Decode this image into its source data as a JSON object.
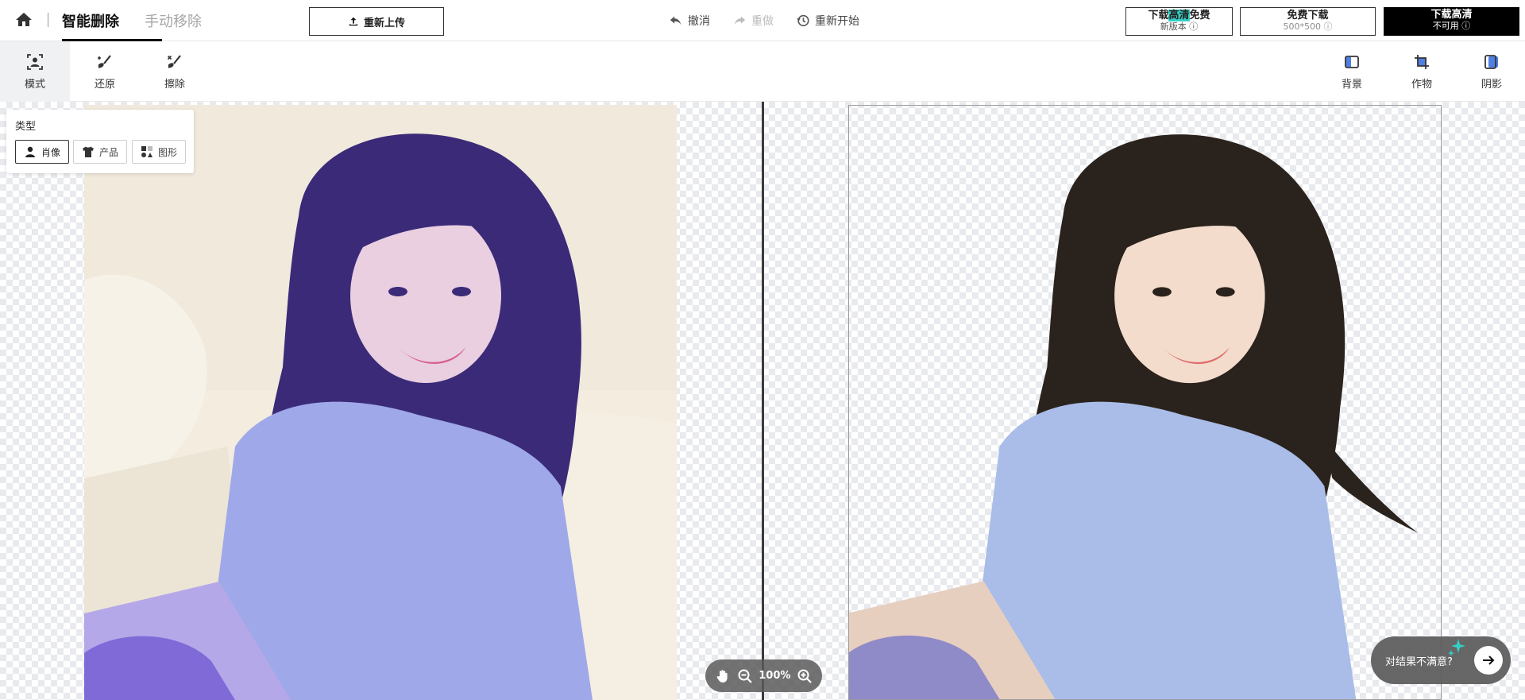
{
  "header": {
    "tabs": [
      {
        "label": "智能删除",
        "active": true
      },
      {
        "label": "手动移除",
        "active": false
      }
    ],
    "upload_label": "重新上传",
    "history": {
      "undo": "撤消",
      "redo": "重做",
      "restart": "重新开始"
    },
    "downloads": {
      "hd_free": {
        "line1_prefix": "下载",
        "line1_highlight": "高清",
        "line1_suffix": "免费",
        "line2": "新版本 ⓘ"
      },
      "free": {
        "line1": "免费下载",
        "line2": "500*500 ⓘ"
      },
      "hd": {
        "line1": "下载高清",
        "line2": "不可用 ⓘ"
      }
    }
  },
  "toolbar": {
    "left": [
      {
        "label": "模式"
      },
      {
        "label": "还原"
      },
      {
        "label": "擦除"
      }
    ],
    "right": [
      {
        "label": "背景"
      },
      {
        "label": "作物"
      },
      {
        "label": "阴影"
      }
    ]
  },
  "type_panel": {
    "title": "类型",
    "options": [
      {
        "label": "肖像",
        "selected": true
      },
      {
        "label": "产品",
        "selected": false
      },
      {
        "label": "图形",
        "selected": false
      }
    ]
  },
  "zoom": {
    "level": "100%"
  },
  "feedback": {
    "label": "对结果不满意?"
  },
  "colors": {
    "accent": "#000000",
    "highlight": "#34d0c8",
    "checker": "#e8eaee"
  },
  "icons": [
    "home-icon",
    "upload-icon",
    "undo-icon",
    "redo-icon",
    "history-icon",
    "mode-icon",
    "restore-brush-icon",
    "erase-brush-icon",
    "background-icon",
    "crop-icon",
    "shadow-icon",
    "portrait-icon",
    "shirt-icon",
    "shapes-icon",
    "hand-icon",
    "zoom-out-icon",
    "zoom-in-icon",
    "arrow-right-icon",
    "sparkle-icon"
  ]
}
